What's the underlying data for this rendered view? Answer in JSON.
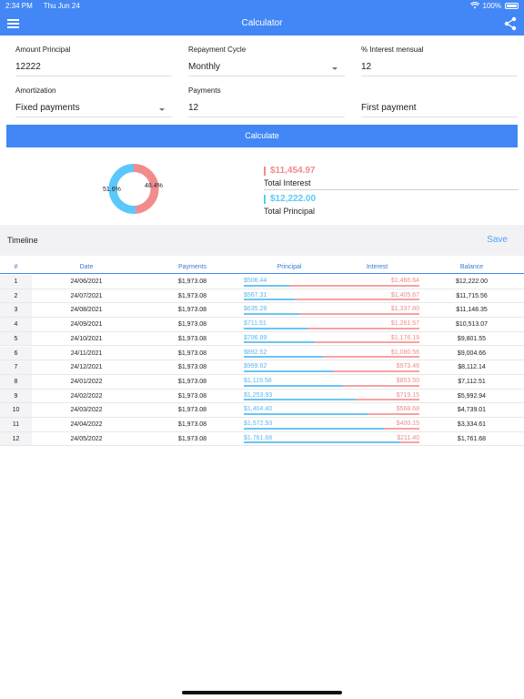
{
  "status": {
    "time": "2:34 PM",
    "date": "Thu Jun 24",
    "battery": "100%"
  },
  "nav": {
    "title": "Calculator"
  },
  "form": {
    "principal_label": "Amount Principal",
    "principal_value": "12222",
    "cycle_label": "Repayment Cycle",
    "cycle_value": "Monthly",
    "interest_label": "% Interest mensual",
    "interest_value": "12",
    "amortization_label": "Amortization",
    "amortization_value": "Fixed payments",
    "payments_label": "Payments",
    "payments_value": "12",
    "first_payment_value": "First payment"
  },
  "calculate_label": "Calculate",
  "summary": {
    "interest_amount": "$11,454.97",
    "interest_label": "Total Interest",
    "principal_amount": "$12,222.00",
    "principal_label": "Total Principal",
    "donut_principal_pct": "51.6%",
    "donut_interest_pct": "48.4%",
    "principal_fraction": 0.516,
    "interest_fraction": 0.484,
    "principal_color": "#5ac8fa",
    "interest_color": "#f28b8b"
  },
  "timeline": {
    "title": "Timeline",
    "save_label": "Save"
  },
  "table": {
    "headers": [
      "#",
      "Date",
      "Payments",
      "Principal",
      "Interest",
      "Balance"
    ],
    "rows": [
      {
        "n": "1",
        "date": "24/06/2021",
        "payment": "$1,973.08",
        "principal": "$506.44",
        "interest": "$1,466.64",
        "balance": "$12,222.00",
        "pfrac": 0.257
      },
      {
        "n": "2",
        "date": "24/07/2021",
        "payment": "$1,973.08",
        "principal": "$567.31",
        "interest": "$1,405.67",
        "balance": "$11,715.56",
        "pfrac": 0.288
      },
      {
        "n": "3",
        "date": "24/08/2021",
        "payment": "$1,973.08",
        "principal": "$635.28",
        "interest": "$1,337.80",
        "balance": "$11,148.35",
        "pfrac": 0.322
      },
      {
        "n": "4",
        "date": "24/09/2021",
        "payment": "$1,973.08",
        "principal": "$711.51",
        "interest": "$1,261.57",
        "balance": "$10,513.07",
        "pfrac": 0.361
      },
      {
        "n": "5",
        "date": "24/10/2021",
        "payment": "$1,973.08",
        "principal": "$796.89",
        "interest": "$1,176.19",
        "balance": "$9,801.55",
        "pfrac": 0.404
      },
      {
        "n": "6",
        "date": "24/11/2021",
        "payment": "$1,973.08",
        "principal": "$892.52",
        "interest": "$1,080.56",
        "balance": "$9,004.66",
        "pfrac": 0.452
      },
      {
        "n": "7",
        "date": "24/12/2021",
        "payment": "$1,973.08",
        "principal": "$999.62",
        "interest": "$973.46",
        "balance": "$8,112.14",
        "pfrac": 0.507
      },
      {
        "n": "8",
        "date": "24/01/2022",
        "payment": "$1,973.08",
        "principal": "$1,119.58",
        "interest": "$853.50",
        "balance": "$7,112.51",
        "pfrac": 0.567
      },
      {
        "n": "9",
        "date": "24/02/2022",
        "payment": "$1,973.08",
        "principal": "$1,253.93",
        "interest": "$719.15",
        "balance": "$5,992.94",
        "pfrac": 0.636
      },
      {
        "n": "10",
        "date": "24/03/2022",
        "payment": "$1,973.08",
        "principal": "$1,404.40",
        "interest": "$568.68",
        "balance": "$4,739.01",
        "pfrac": 0.712
      },
      {
        "n": "11",
        "date": "24/04/2022",
        "payment": "$1,973.08",
        "principal": "$1,572.93",
        "interest": "$400.15",
        "balance": "$3,334.61",
        "pfrac": 0.797
      },
      {
        "n": "12",
        "date": "24/05/2022",
        "payment": "$1,973.08",
        "principal": "$1,761.68",
        "interest": "$211.40",
        "balance": "$1,761.68",
        "pfrac": 0.893
      }
    ]
  }
}
